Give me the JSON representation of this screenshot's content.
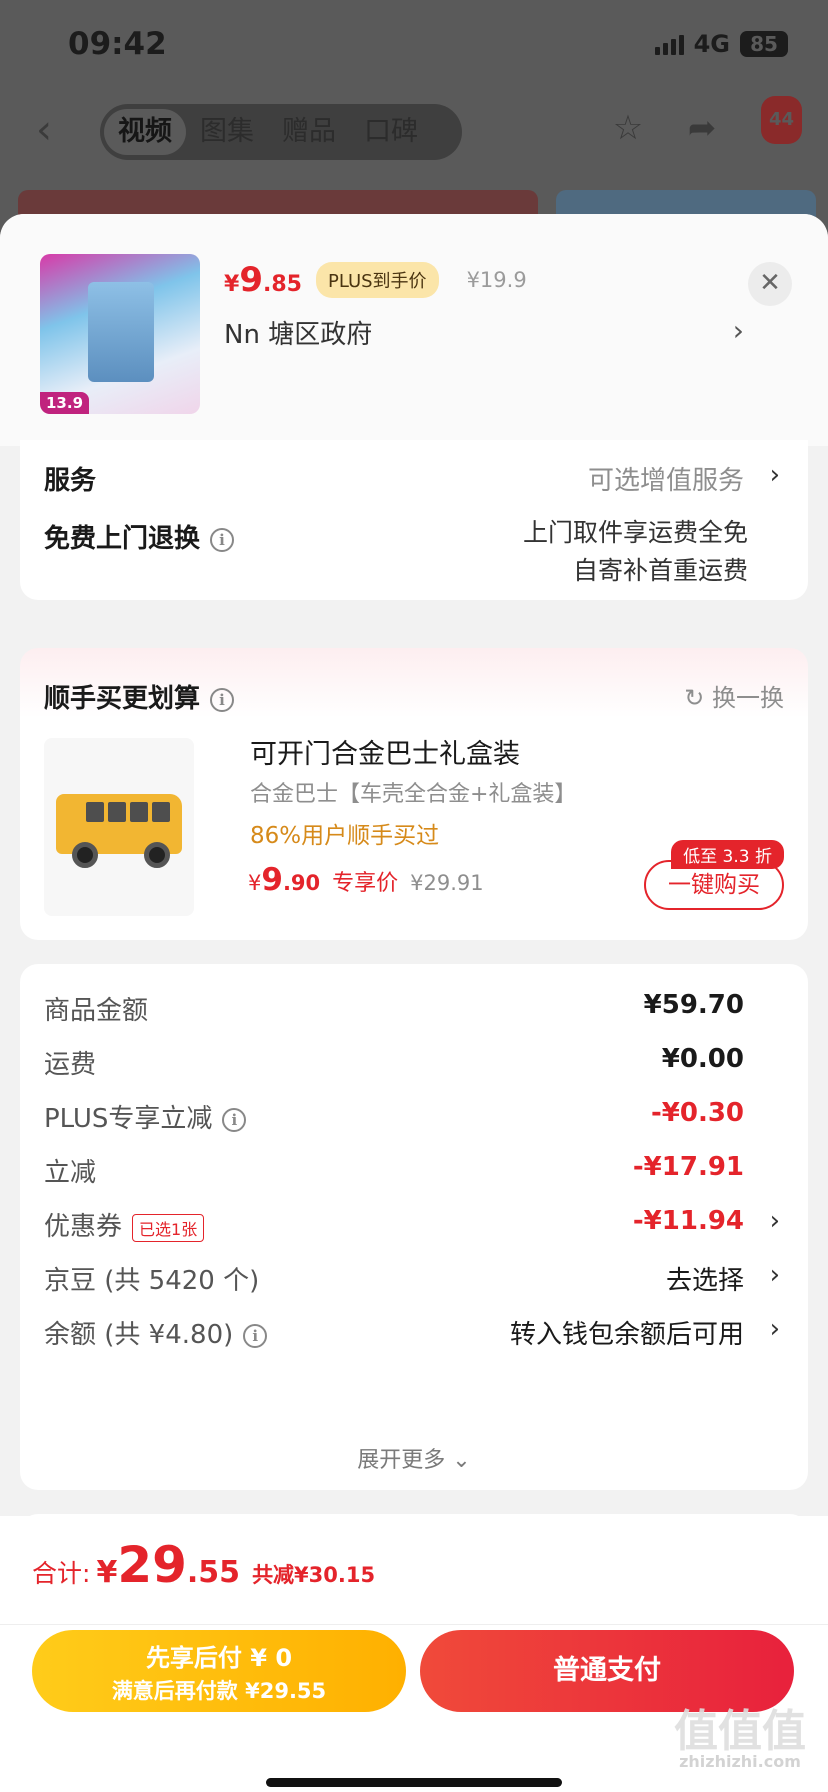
{
  "status_bar": {
    "time": "09:42",
    "network": "4G",
    "battery": "85"
  },
  "nav": {
    "tabs": [
      {
        "label": "视频"
      },
      {
        "label": "图集"
      },
      {
        "label": "赠品"
      },
      {
        "label": "口碑"
      }
    ],
    "message_count": "44"
  },
  "product": {
    "thumb_price": "13.9",
    "price_currency": "¥",
    "price_int": "9",
    "price_dec": ".85",
    "plus_tag": "PLUS到手价",
    "orig_price": "¥19.9",
    "address": "Nn  塘区政府"
  },
  "services": {
    "label": "服务",
    "value": "可选增值服务",
    "return_label": "免费上门退换",
    "return_line1": "上门取件享运费全免",
    "return_line2": "自寄补首重运费"
  },
  "recommend": {
    "title": "顺手买更划算",
    "swap": "换一换",
    "item": {
      "name": "可开门合金巴士礼盒装",
      "desc": "合金巴士【车壳全合金+礼盒装】",
      "social": "86%用户顺手买过",
      "price_currency": "¥",
      "price_int": "9",
      "price_dec": ".90",
      "price_tag": "专享价",
      "orig_price": "¥29.91",
      "discount_badge": "低至 3.3 折",
      "buy_label": "一键购买"
    }
  },
  "fees": {
    "rows": [
      {
        "label": "商品金额",
        "value": "¥59.70"
      },
      {
        "label": "运费",
        "value": "¥0.00"
      },
      {
        "label": "PLUS专享立减",
        "value": "-¥0.30"
      },
      {
        "label": "立减",
        "value": "-¥17.91"
      },
      {
        "label": "优惠券",
        "tag": "已选1张",
        "value": "-¥11.94"
      },
      {
        "label": "京豆 (共 5420 个)",
        "value": "去选择"
      },
      {
        "label": "余额 (共 ¥4.80)",
        "value": "转入钱包余额后可用"
      }
    ],
    "expand": "展开更多"
  },
  "bottom": {
    "total_label": "合计:",
    "total_currency": "¥",
    "total_int": "29",
    "total_dec": ".55",
    "total_save": "共减¥30.15",
    "pay_later_line1": "先享后付 ¥ 0",
    "pay_later_line2": "满意后再付款 ¥29.55",
    "pay_normal": "普通支付"
  },
  "watermark": {
    "main": "值值值",
    "sub": "zhizhizhi.com"
  },
  "colors": {
    "accent_red": "#e4242b",
    "plus_gold": "#fbe5a9",
    "pay_later_yellow": "#ffbf0d",
    "social_orange": "#d68a1a"
  }
}
